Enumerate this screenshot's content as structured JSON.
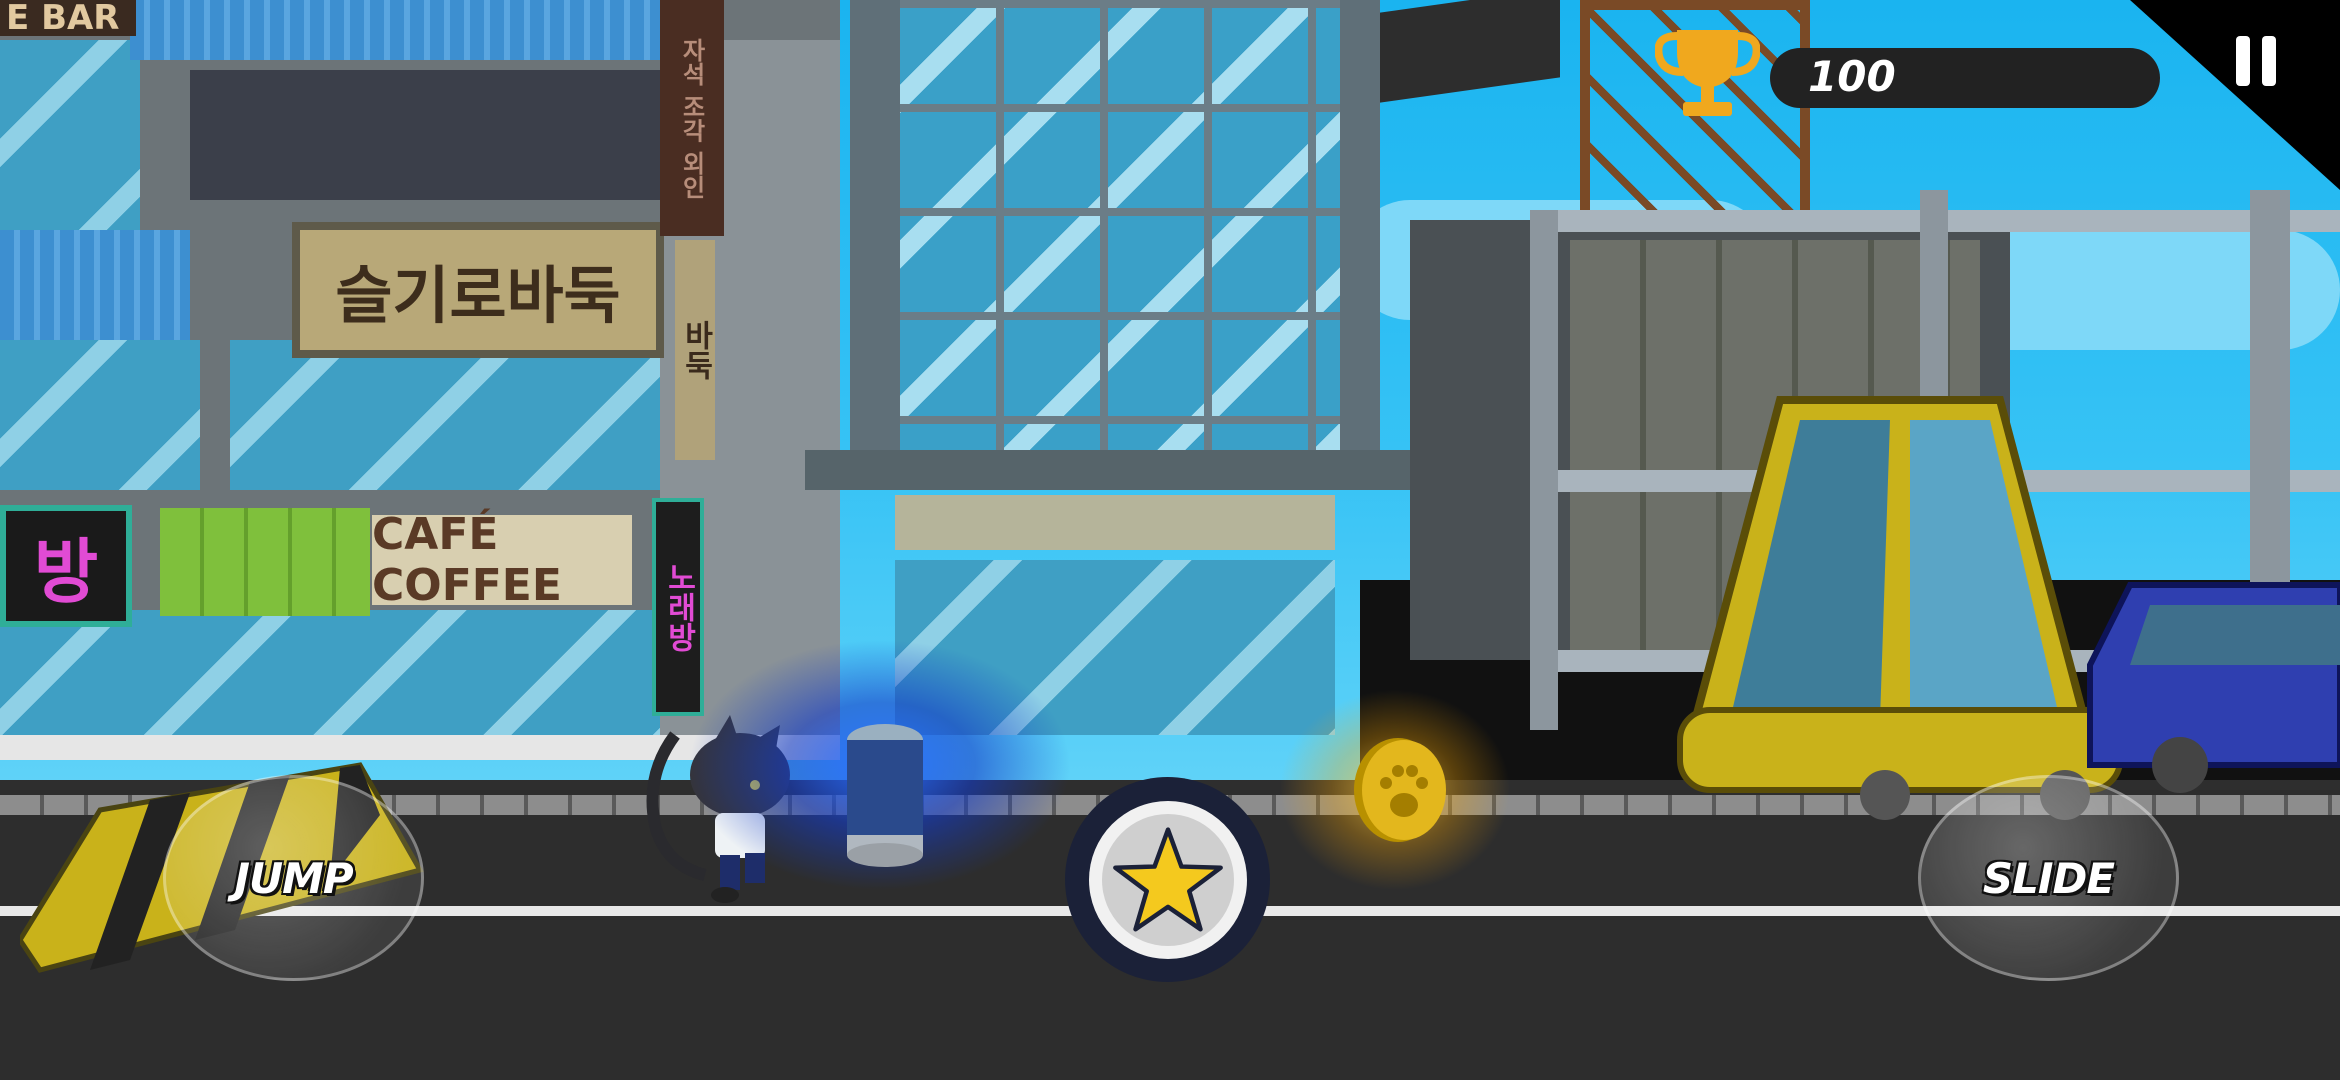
{
  "hud": {
    "score": "100",
    "trophy_icon": "trophy-icon",
    "pause_icon": "pause-icon"
  },
  "controls": {
    "jump_label": "JUMP",
    "slide_label": "SLIDE",
    "special_icon": "star-icon"
  },
  "scene": {
    "signs": {
      "bar_partial": "E BAR",
      "baduk": "슬기로바둑",
      "cafe": "CAFÉ COFFEE",
      "bang_left": "방",
      "vertical_red": "자석 조각 외인",
      "vertical_right": "바둑",
      "vertical_pink": "노래방"
    }
  },
  "colors": {
    "sky": "#1ab4f0",
    "road": "#2d2d2d",
    "taxi_yellow": "#c9b21a",
    "car_blue": "#2f3fb0",
    "coin_gold": "#e3b71d",
    "trophy_gold": "#f0a81e"
  }
}
